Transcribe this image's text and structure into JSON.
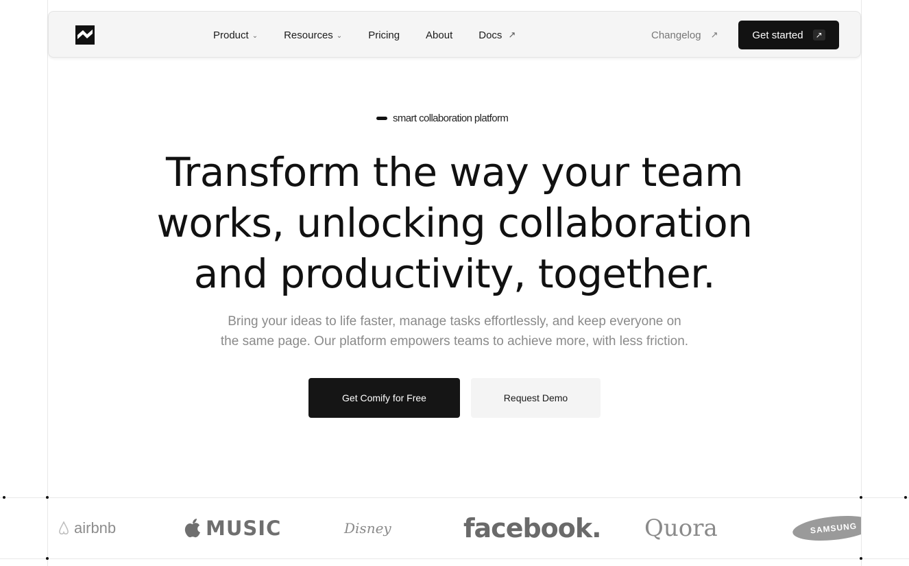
{
  "nav": {
    "items": [
      {
        "label": "Product",
        "has_dropdown": true
      },
      {
        "label": "Resources",
        "has_dropdown": true
      },
      {
        "label": "Pricing"
      },
      {
        "label": "About"
      },
      {
        "label": "Docs",
        "external": true
      }
    ],
    "external_arrow": "↗",
    "dropdown_chevron": "⌄",
    "changelog_label": "Changelog",
    "cta_label": "Get started"
  },
  "hero": {
    "tagline": "smart collaboration platform",
    "headline_line1": "Transform the way your team",
    "headline_line2": "works, unlocking collaboration",
    "headline_line3": "and productivity, together.",
    "subtext_line1": "Bring your ideas to life faster, manage tasks effortlessly, and keep everyone on",
    "subtext_line2": "the same page. Our platform empowers teams to achieve more, with less friction.",
    "primary_button": "Get Comify for Free",
    "secondary_button": "Request Demo"
  },
  "logos": {
    "airbnb": "airbnb",
    "music": "MUSIC",
    "disney": "Disney",
    "facebook": "facebook.",
    "quora": "Quora",
    "samsung": "SAMSUNG"
  },
  "colors": {
    "dark": "#121212",
    "muted_text": "#8a8a8a",
    "nav_bg": "#f5f5f5"
  }
}
